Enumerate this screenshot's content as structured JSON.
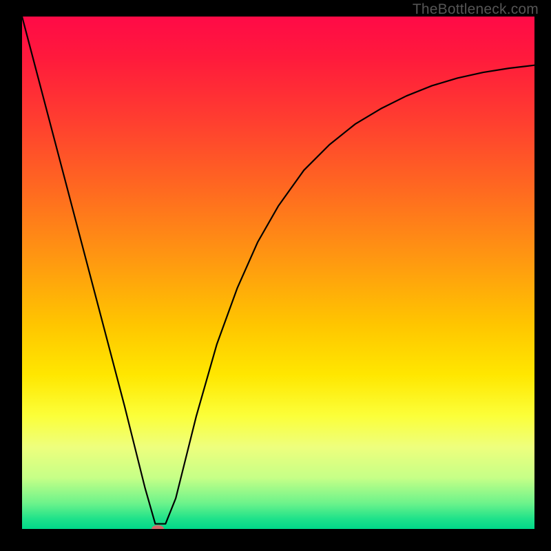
{
  "watermark": "TheBottleneck.com",
  "chart_data": {
    "type": "line",
    "title": "",
    "xlabel": "",
    "ylabel": "",
    "xlim": [
      0,
      100
    ],
    "ylim": [
      0,
      100
    ],
    "grid": false,
    "legend": false,
    "series": [
      {
        "name": "curve",
        "x": [
          0,
          5,
          10,
          15,
          20,
          24,
          26,
          28,
          30,
          32,
          34,
          38,
          42,
          46,
          50,
          55,
          60,
          65,
          70,
          75,
          80,
          85,
          90,
          95,
          100
        ],
        "y": [
          100,
          81,
          62,
          43,
          24,
          8,
          1,
          1,
          6,
          14,
          22,
          36,
          47,
          56,
          63,
          70,
          75,
          79,
          82,
          84.5,
          86.5,
          88,
          89.1,
          89.9,
          90.5
        ]
      }
    ],
    "minimum_marker": {
      "x": 26.5,
      "y": 0
    },
    "gradient_direction": "vertical",
    "gradient_stops": [
      {
        "y": 100,
        "color": "#ff0a47"
      },
      {
        "y": 60,
        "color": "#ff9a10"
      },
      {
        "y": 30,
        "color": "#ffe700"
      },
      {
        "y": 10,
        "color": "#c6ff87"
      },
      {
        "y": 0,
        "color": "#00d889"
      }
    ]
  }
}
